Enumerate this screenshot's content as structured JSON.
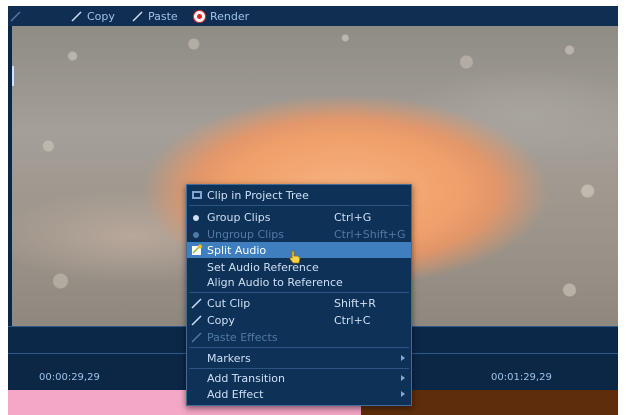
{
  "toolbar": {
    "items": [
      {
        "label": "Copy",
        "icon": "pen-icon"
      },
      {
        "label": "Paste",
        "icon": "pen-icon"
      },
      {
        "label": "Render",
        "icon": "record-icon"
      }
    ]
  },
  "timeline": {
    "timecode_left": "00:00:29,29",
    "timecode_right": "00:01:29,29"
  },
  "context_menu": {
    "items": [
      {
        "label": "Clip in Project Tree",
        "shortcut": "",
        "icon": "clip-icon",
        "state": "enabled"
      },
      {
        "label": "Group Clips",
        "shortcut": "Ctrl+G",
        "icon": "group-icon",
        "state": "enabled"
      },
      {
        "label": "Ungroup Clips",
        "shortcut": "Ctrl+Shift+G",
        "icon": "ungroup-icon",
        "state": "disabled"
      },
      {
        "label": "Split Audio",
        "shortcut": "",
        "icon": "split-audio-icon",
        "state": "highlighted"
      },
      {
        "label": "Set Audio Reference",
        "shortcut": "",
        "icon": "",
        "state": "enabled"
      },
      {
        "label": "Align Audio to Reference",
        "shortcut": "",
        "icon": "",
        "state": "enabled"
      },
      {
        "label": "Cut Clip",
        "shortcut": "Shift+R",
        "icon": "cut-icon",
        "state": "enabled"
      },
      {
        "label": "Copy",
        "shortcut": "Ctrl+C",
        "icon": "copy-icon",
        "state": "enabled"
      },
      {
        "label": "Paste Effects",
        "shortcut": "",
        "icon": "paste-icon",
        "state": "disabled"
      },
      {
        "label": "Markers",
        "shortcut": "",
        "icon": "",
        "state": "submenu"
      },
      {
        "label": "Add Transition",
        "shortcut": "",
        "icon": "",
        "state": "submenu"
      },
      {
        "label": "Add Effect",
        "shortcut": "",
        "icon": "",
        "state": "submenu"
      }
    ]
  },
  "colors": {
    "background": "#0c2746",
    "highlight": "#3f7fc0",
    "menu_text": "#cfe0f4",
    "disabled_text": "#4f7aa6",
    "track_pink": "#f4a7c6",
    "track_brown": "#5e2d0b"
  }
}
